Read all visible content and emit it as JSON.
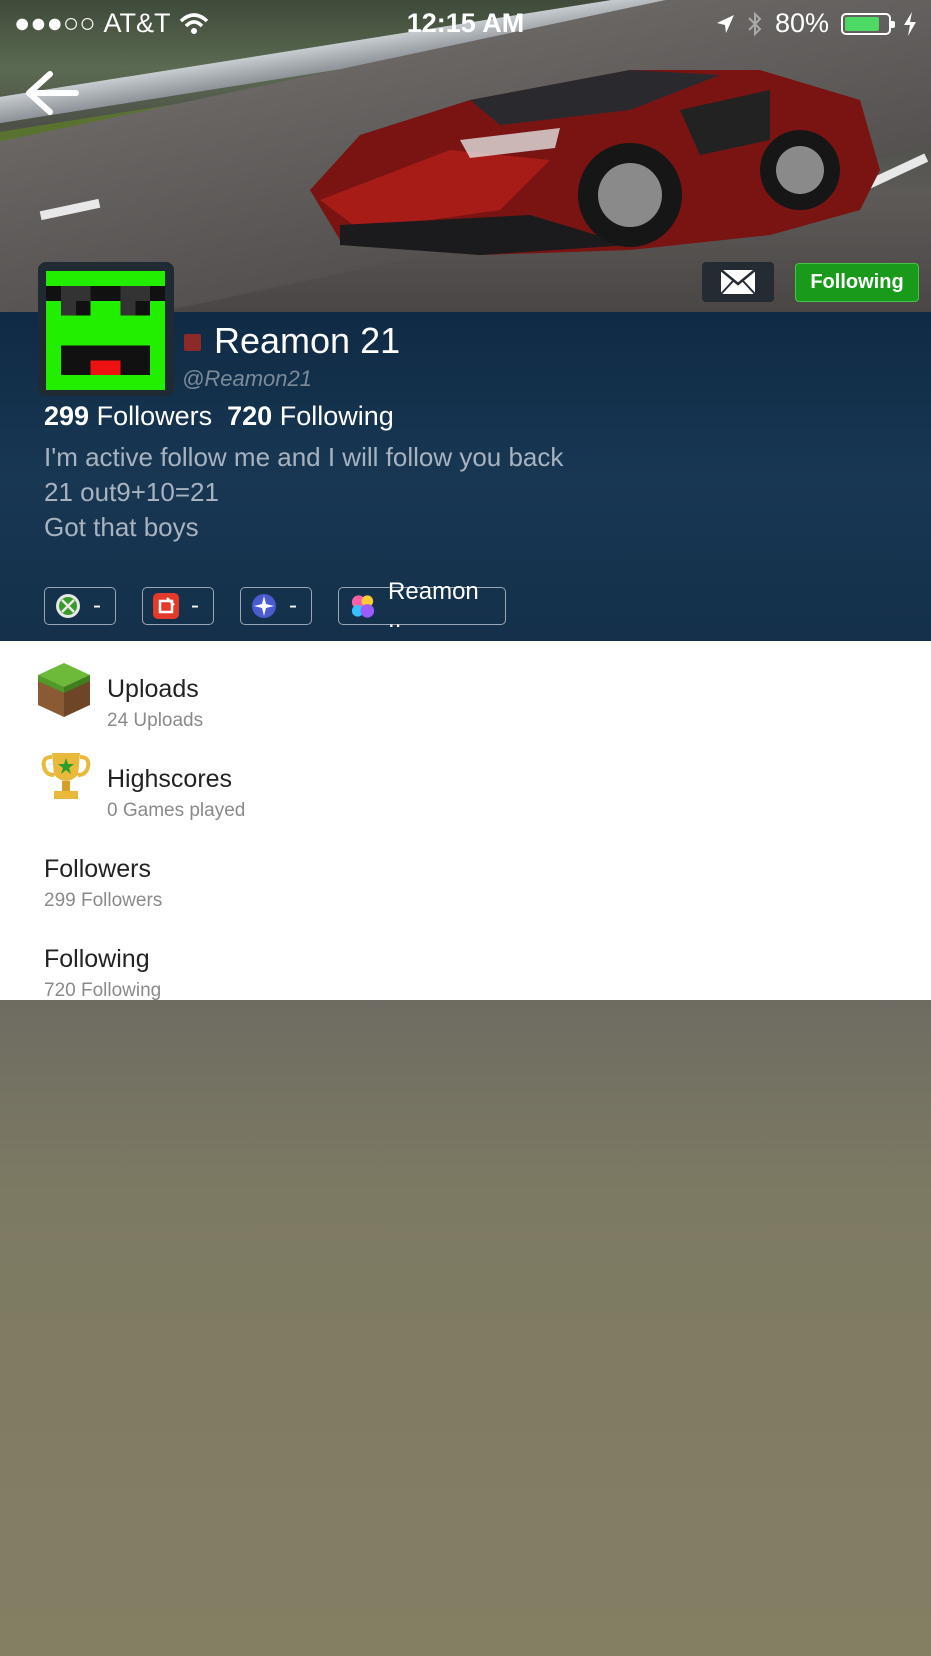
{
  "status_bar": {
    "signal": "●●●○○",
    "carrier": "AT&T",
    "time": "12:15 AM",
    "battery": "80%",
    "battery_level": 0.8
  },
  "header": {
    "following_label": "Following"
  },
  "profile": {
    "name": "Reamon 21",
    "handle": "@Reamon21",
    "followers_count": "299",
    "followers_label": "Followers",
    "following_count": "720",
    "following_label": "Following",
    "bio": [
      "I'm active follow me and I will follow you back",
      "21 out9+10=21",
      "Got that boys"
    ]
  },
  "accounts": [
    {
      "icon": "xbox-icon",
      "value": "-"
    },
    {
      "icon": "game-app-icon",
      "value": "-"
    },
    {
      "icon": "starburst-icon",
      "value": "-"
    },
    {
      "icon": "game-center-icon",
      "value": "Reamon .."
    }
  ],
  "menu": [
    {
      "title": "Uploads",
      "subtitle": "24 Uploads",
      "icon": "grass-block-icon"
    },
    {
      "title": "Highscores",
      "subtitle": "0 Games played",
      "icon": "trophy-icon"
    },
    {
      "title": "Followers",
      "subtitle": "299 Followers"
    },
    {
      "title": "Following",
      "subtitle": "720 Following"
    }
  ]
}
